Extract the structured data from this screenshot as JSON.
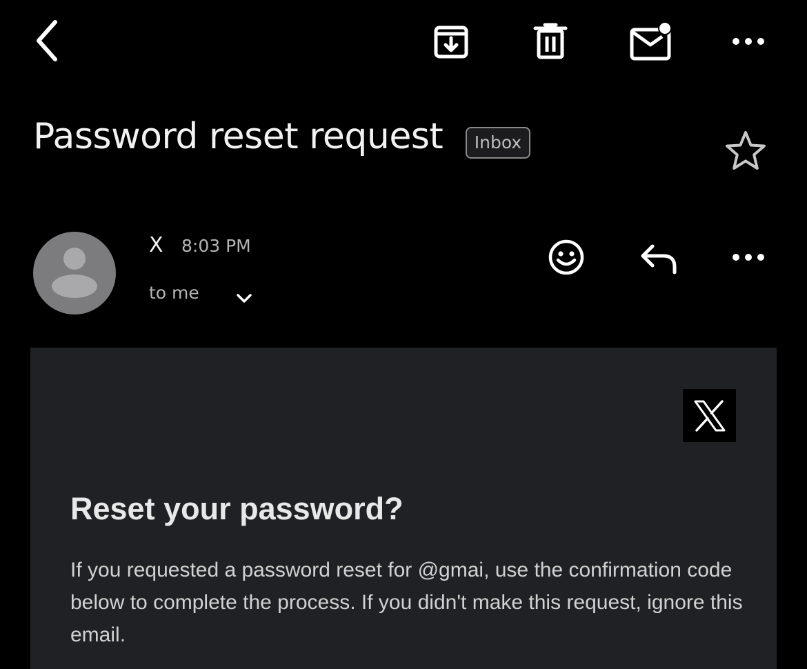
{
  "toolbar": {
    "back_icon": "chevron-left-icon",
    "archive_icon": "archive-icon",
    "delete_icon": "trash-icon",
    "mark_unread_icon": "mail-unread-icon",
    "more_icon": "more-horizontal-icon"
  },
  "email": {
    "subject": "Password reset request",
    "label": "Inbox",
    "star_icon": "star-outline-icon",
    "sender_name": "X",
    "time": "8:03 PM",
    "recipient": "to me",
    "actions": {
      "emoji_icon": "emoji-reaction-icon",
      "reply_icon": "reply-icon",
      "more_icon": "more-horizontal-icon"
    }
  },
  "body": {
    "logo": "X",
    "title": "Reset your password?",
    "text": "If you requested a password reset for @gmai, use the confirmation code below to complete the process. If you didn't make this request, ignore this email."
  },
  "colors": {
    "background": "#000000",
    "card": "#202124",
    "avatar": "#7c7c7e",
    "secondary_text": "#b5b5b5"
  }
}
